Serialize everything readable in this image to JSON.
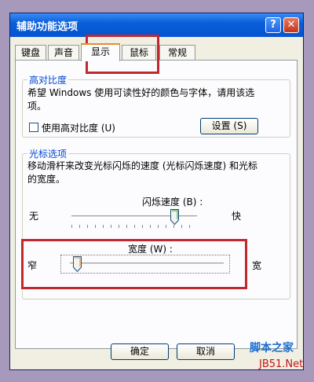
{
  "window": {
    "title": "辅助功能选项",
    "help_glyph": "?",
    "close_glyph": "✕"
  },
  "tabs": [
    "键盘",
    "声音",
    "显示",
    "鼠标",
    "常规"
  ],
  "active_tab": "显示",
  "contrast": {
    "group_title": "高对比度",
    "description_line1": "希望 Windows 使用可读性好的颜色与字体，请用该选",
    "description_line2": "项。",
    "checkbox_label": "使用高对比度 (U)",
    "checked": false,
    "settings_label": "设置 (S)"
  },
  "cursor": {
    "group_title": "光标选项",
    "description_line1": "移动滑杆来改变光标闪烁的速度 (光标闪烁速度) 和光标",
    "description_line2": "的宽度。",
    "blink": {
      "label": "闪烁速度 (B) :",
      "min_label": "无",
      "max_label": "快",
      "value": 0.82
    },
    "width": {
      "label": "宽度 (W) :",
      "min_label": "窄",
      "max_label": "宽",
      "value": 0.05
    }
  },
  "buttons": {
    "ok": "确定",
    "cancel": "取消"
  },
  "watermark": {
    "cn": "脚本之家",
    "url": "JB51.Net"
  },
  "colors": {
    "titlebar": "#0553d0",
    "highlight": "#c0282d",
    "legend": "#0046d5"
  }
}
